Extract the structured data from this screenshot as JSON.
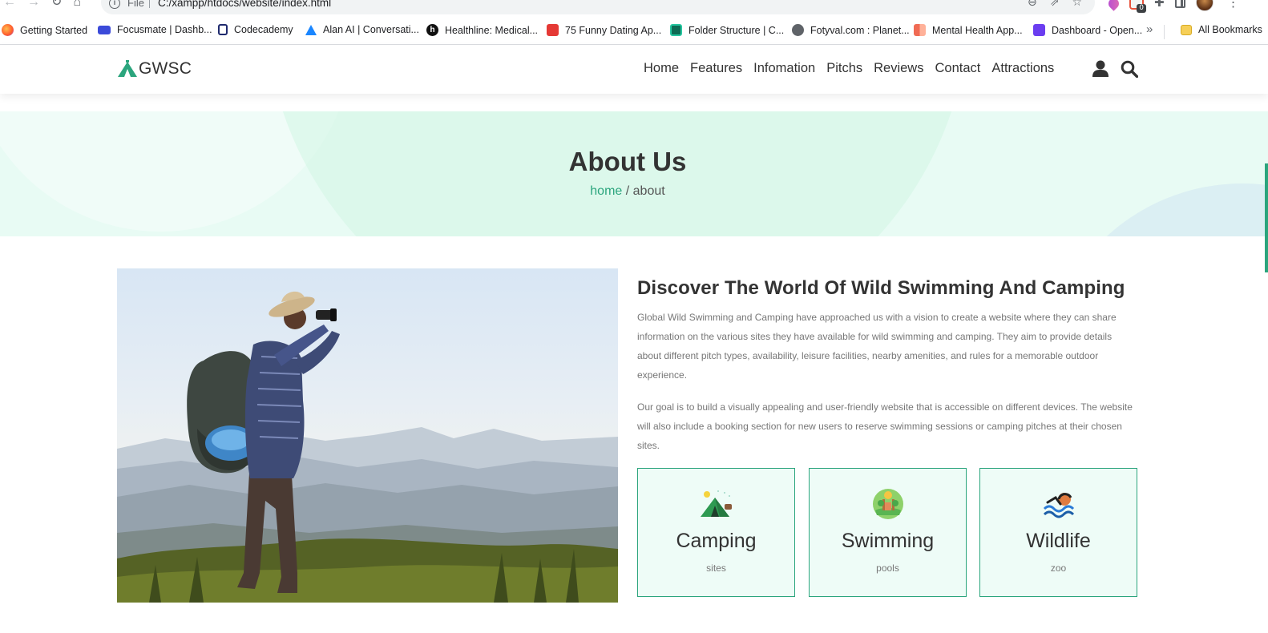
{
  "browser": {
    "file_label": "File",
    "url": "C:/xampp/htdocs/website/index.html",
    "extension_badge": "0",
    "bookmarks": [
      {
        "label": "Getting Started",
        "icon": "firefox-icon"
      },
      {
        "label": "Focusmate | Dashb...",
        "icon": "video-icon"
      },
      {
        "label": "Codecademy",
        "icon": "codecademy-icon"
      },
      {
        "label": "Alan AI | Conversati...",
        "icon": "alan-icon"
      },
      {
        "label": "Healthline: Medical...",
        "icon": "healthline-icon"
      },
      {
        "label": "75 Funny Dating Ap...",
        "icon": "dating-icon"
      },
      {
        "label": "Folder Structure | C...",
        "icon": "folder-structure-icon"
      },
      {
        "label": "Fotyval.com : Planet...",
        "icon": "globe-icon"
      },
      {
        "label": "Mental Health App...",
        "icon": "mental-health-icon"
      },
      {
        "label": "Dashboard - Open...",
        "icon": "dashboard-icon"
      }
    ],
    "more_bookmarks": "»",
    "all_bookmarks": "All Bookmarks"
  },
  "site": {
    "logo_text": "GWSC",
    "nav": [
      "Home",
      "Features",
      "Infomation",
      "Pitchs",
      "Reviews",
      "Contact",
      "Attractions"
    ],
    "accent_color": "#2ba57d"
  },
  "banner": {
    "title": "About Us",
    "crumb_home": "home",
    "crumb_sep": " / ",
    "crumb_current": "about"
  },
  "about": {
    "image_alt": "hiker with backpack looking through binoculars over mountains",
    "title": "Discover The World Of Wild Swimming And Camping",
    "paragraphs": [
      "Global Wild Swimming and Camping have approached us with a vision to create a website where they can share information on the various sites they have available for wild swimming and camping. They aim to provide details about different pitch types, availability, leisure facilities, nearby amenities, and rules for a memorable outdoor experience.",
      "Our goal is to build a visually appealing and user-friendly website that is accessible on different devices. The website will also include a booking section for new users to reserve swimming sessions or camping pitches at their chosen sites."
    ],
    "cards": [
      {
        "title": "Camping",
        "subtitle": "sites",
        "icon": "tent-icon"
      },
      {
        "title": "Swimming",
        "subtitle": "pools",
        "icon": "nature-icon"
      },
      {
        "title": "Wildlife",
        "subtitle": "zoo",
        "icon": "swimmer-icon"
      }
    ]
  }
}
